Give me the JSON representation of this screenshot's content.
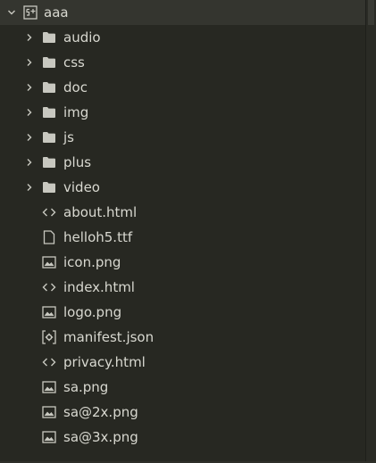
{
  "tree": {
    "root": {
      "label": "aaa",
      "icon": "project-folder-icon",
      "expanded": true
    },
    "children": [
      {
        "label": "audio",
        "type": "folder",
        "icon": "folder-icon",
        "expandable": true
      },
      {
        "label": "css",
        "type": "folder",
        "icon": "folder-icon",
        "expandable": true
      },
      {
        "label": "doc",
        "type": "folder",
        "icon": "folder-icon",
        "expandable": true
      },
      {
        "label": "img",
        "type": "folder",
        "icon": "folder-icon",
        "expandable": true
      },
      {
        "label": "js",
        "type": "folder",
        "icon": "folder-icon",
        "expandable": true
      },
      {
        "label": "plus",
        "type": "folder",
        "icon": "folder-icon",
        "expandable": true
      },
      {
        "label": "video",
        "type": "folder",
        "icon": "folder-icon",
        "expandable": true
      },
      {
        "label": "about.html",
        "type": "file",
        "icon": "code-file-icon"
      },
      {
        "label": "helloh5.ttf",
        "type": "file",
        "icon": "file-icon"
      },
      {
        "label": "icon.png",
        "type": "file",
        "icon": "image-file-icon"
      },
      {
        "label": "index.html",
        "type": "file",
        "icon": "code-file-icon"
      },
      {
        "label": "logo.png",
        "type": "file",
        "icon": "image-file-icon"
      },
      {
        "label": "manifest.json",
        "type": "file",
        "icon": "settings-file-icon"
      },
      {
        "label": "privacy.html",
        "type": "file",
        "icon": "code-file-icon"
      },
      {
        "label": "sa.png",
        "type": "file",
        "icon": "image-file-icon"
      },
      {
        "label": "sa@2x.png",
        "type": "file",
        "icon": "image-file-icon"
      },
      {
        "label": "sa@3x.png",
        "type": "file",
        "icon": "image-file-icon"
      }
    ]
  },
  "colors": {
    "background": "#272822",
    "root_highlight": "#34352f",
    "text": "#d8d8d0",
    "icon": "#c8c8c0"
  }
}
